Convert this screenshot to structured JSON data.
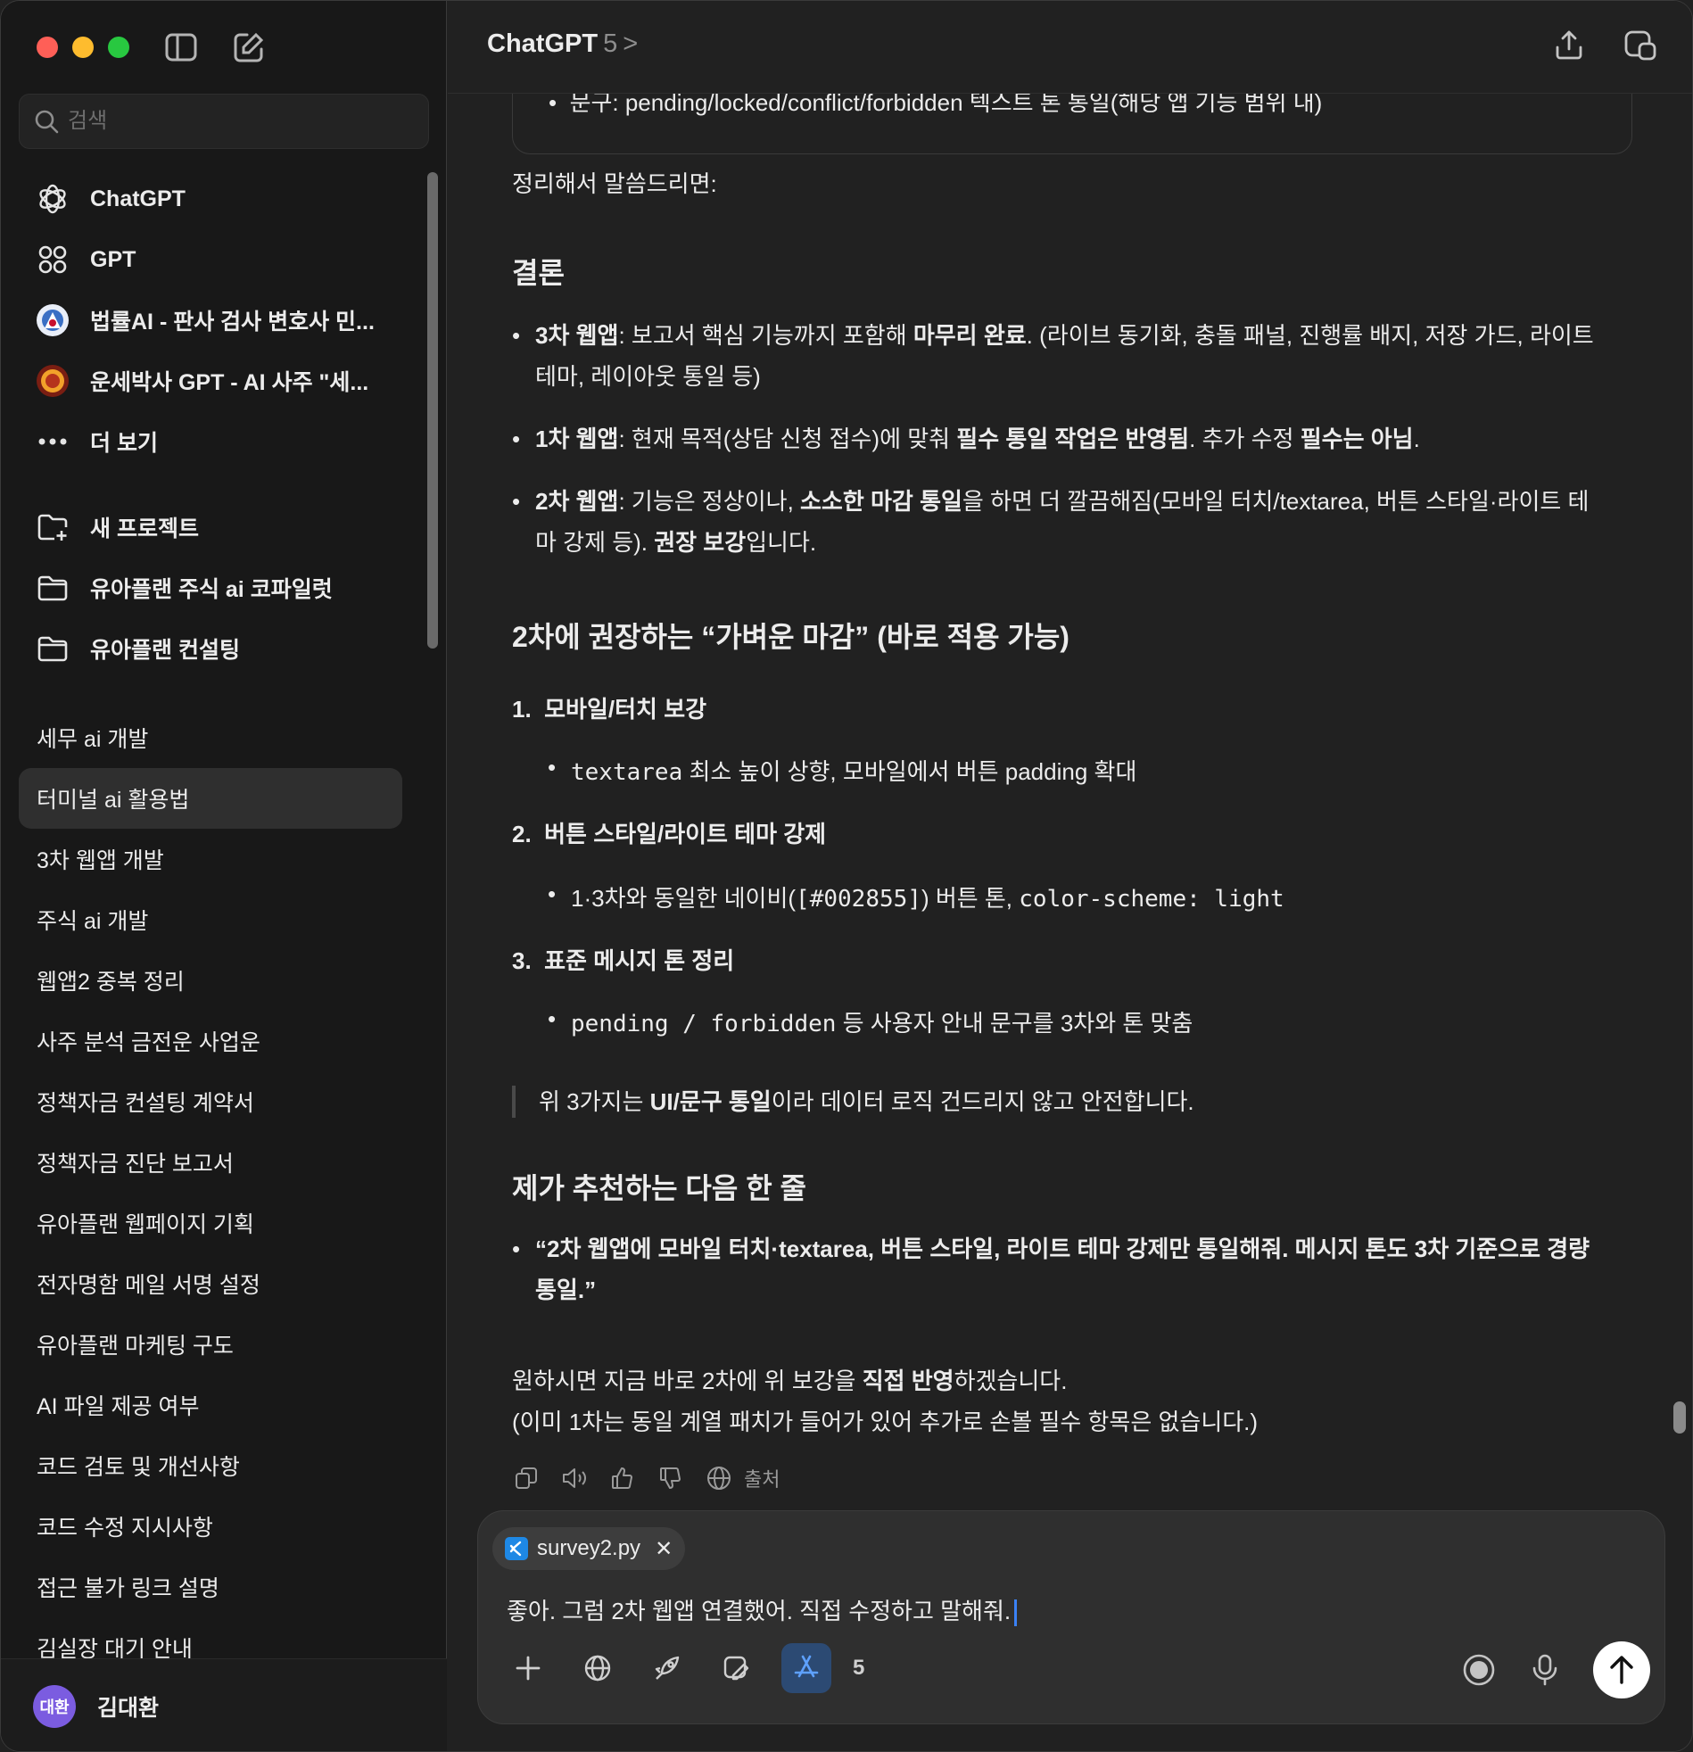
{
  "sidebar": {
    "search_placeholder": "검색",
    "nav": [
      {
        "label": "ChatGPT",
        "icon": "openai-logo-icon"
      },
      {
        "label": "GPT",
        "icon": "grid-icon"
      },
      {
        "label": "법률AI - 판사 검사 변호사 민...",
        "icon": "avatar-icon"
      },
      {
        "label": "운세박사 GPT - AI 사주 \"세...",
        "icon": "avatar-icon"
      },
      {
        "label": "더 보기",
        "icon": "more-icon"
      }
    ],
    "projects": [
      {
        "label": "새 프로젝트",
        "icon": "new-folder-icon"
      },
      {
        "label": "유아플랜 주식 ai 코파일럿",
        "icon": "folder-icon"
      },
      {
        "label": "유아플랜 컨설팅",
        "icon": "folder-icon"
      }
    ],
    "chats": [
      "세무 ai 개발",
      "터미널 ai 활용법",
      "3차 웹앱 개발",
      "주식 ai 개발",
      "웹앱2 중복 정리",
      "사주 분석 금전운 사업운",
      "정책자금 컨설팅 계약서",
      "정책자금 진단 보고서",
      "유아플랜 웹페이지 기획",
      "전자명함 메일 서명 설정",
      "유아플랜 마케팅 구도",
      "AI 파일 제공 여부",
      "코드 검토 및 개선사항",
      "코드 수정 지시사항",
      "접근 불가 링크 설명",
      "김실장 대기 안내"
    ],
    "active_chat": "터미널 ai 활용법",
    "user": {
      "avatar_text": "대환",
      "name": "김대환",
      "avatar_color": "#7b5ce0"
    }
  },
  "header": {
    "model": "ChatGPT",
    "version": "5",
    "chevron": ">"
  },
  "message": {
    "code_line": "문구: pending/locked/conflict/forbidden 텍스트 톤 통일(해당 앱 기능 범위 내)",
    "intro": "정리해서 말씀드리면:",
    "h_conclusion": "결론",
    "b1": {
      "lead": "3차 웹앱",
      "t1": ": 보고서 핵심 기능까지 포함해 ",
      "strong": "마무리 완료",
      "t2": ". (라이브 동기화, 충돌 패널, 진행률 배지, 저장 가드, 라이트",
      "line2": "테마, 레이아웃 통일 등)"
    },
    "b2": {
      "lead": "1차 웹앱",
      "t1": ": 현재 목적(상담 신청 접수)에 맞춰 ",
      "strong": "필수 통일 작업은 반영됨",
      "t2": ". 추가 수정 ",
      "strong2": "필수는 아님",
      "t3": "."
    },
    "b3": {
      "lead": "2차 웹앱",
      "t1": ": 기능은 정상이나, ",
      "strong": "소소한 마감 통일",
      "t2": "을 하면 더 깔끔해짐(모바일 터치/textarea, 버튼 스타일·라이트 테",
      "line2a": "마 강제 등). ",
      "strong2": "권장 보강",
      "line2b": "입니다."
    },
    "h_recommend": "2차에 권장하는 “가벼운 마감” (바로 적용 가능)",
    "steps": [
      {
        "num": "1.",
        "title": "모바일/터치 보강"
      },
      {
        "num": "2.",
        "title": "버튼 스타일/라이트 테마 강제"
      },
      {
        "num": "3.",
        "title": "표준 메시지 톤 정리"
      }
    ],
    "sub1": {
      "code": "textarea",
      "text": " 최소 높이 상향, 모바일에서 버튼 padding 확대"
    },
    "sub2": {
      "t1": "1·3차와 동일한 네이비(",
      "code1": "[#002855]",
      "t2": ") 버튼 톤, ",
      "code2": "color-scheme: light"
    },
    "sub3": {
      "code": "pending / forbidden",
      "text": " 등 사용자 안내 문구를 3차와 톤 맞춤"
    },
    "quote": {
      "t1": "위 3가지는 ",
      "strong": "UI/문구 통일",
      "t2": "이라 데이터 로직 건드리지 않고 안전합니다."
    },
    "h_next": "제가 추천하는 다음 한 줄",
    "next_line1": "“2차 웹앱에 모바일 터치·textarea, 버튼 스타일, 라이트 테마 강제만 통일해줘. 메시지 톤도 3차 기준으로 경량",
    "next_line2": "통일.”",
    "closing1a": "원하시면 지금 바로 2차에 위 보강을 ",
    "closing1b": "직접 반영",
    "closing1c": "하겠습니다.",
    "closing2": "(이미 1차는 동일 계열 패치가 들어가 있어 추가로 손볼 필수 항목은 없습니다.)",
    "sources_label": "출처"
  },
  "composer": {
    "attachment": "survey2.py",
    "text": "좋아. 그럼 2차 웹앱 연결했어. 직접 수정하고 말해줘.",
    "tool_count": "5",
    "accent": "#5ea1ff"
  }
}
